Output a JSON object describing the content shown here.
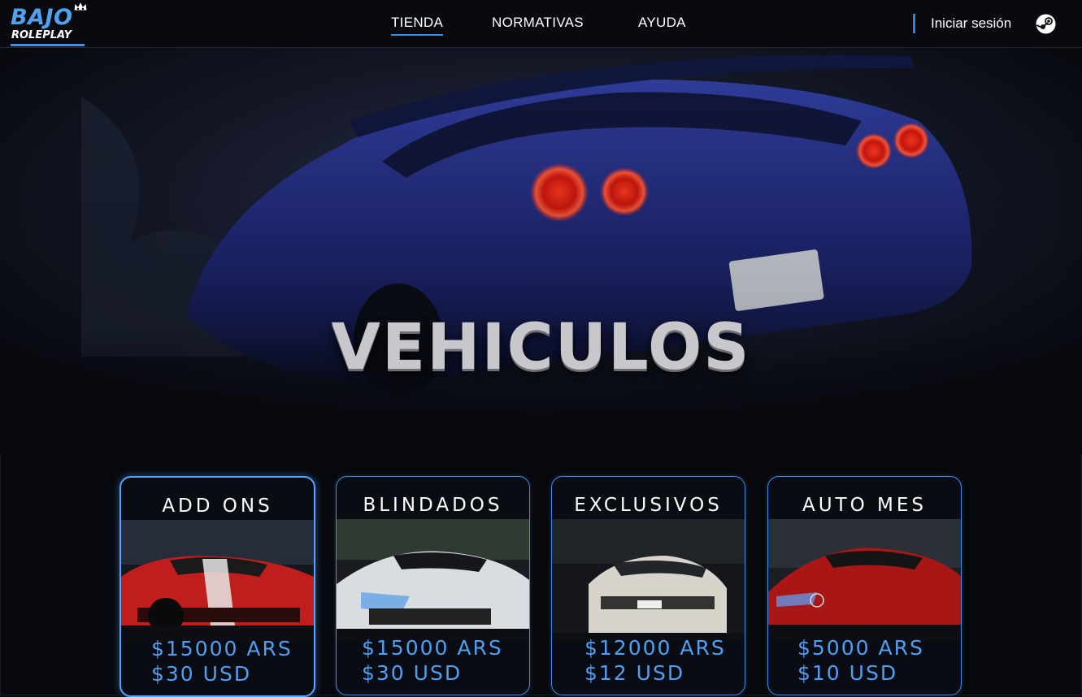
{
  "header": {
    "logo": {
      "top": "BAJO",
      "bottom": "ROLEPLAY"
    },
    "nav": [
      {
        "label": "TIENDA",
        "active": true
      },
      {
        "label": "NORMATIVAS",
        "active": false
      },
      {
        "label": "AYUDA",
        "active": false
      }
    ],
    "login_label": "Iniciar sesión",
    "login_icon": "steam-icon"
  },
  "hero": {
    "title": "VEHICULOS"
  },
  "cards": [
    {
      "title": "ADD ONS",
      "price_ars": "$15000 ARS",
      "price_usd": "$30 USD",
      "image": "red-camaro",
      "selected": true
    },
    {
      "title": "BLINDADOS",
      "price_ars": "$15000 ARS",
      "price_usd": "$30 USD",
      "image": "white-supra",
      "selected": false
    },
    {
      "title": "EXCLUSIVOS",
      "price_ars": "$12000 ARS",
      "price_usd": "$12 USD",
      "image": "white-bmw",
      "selected": false
    },
    {
      "title": "AUTO MES",
      "price_ars": "$5000 ARS",
      "price_usd": "$10 USD",
      "image": "red-mercedes",
      "selected": false
    }
  ],
  "colors": {
    "accent": "#3e8ee8",
    "price": "#4f9ff2",
    "background": "#07080d"
  }
}
